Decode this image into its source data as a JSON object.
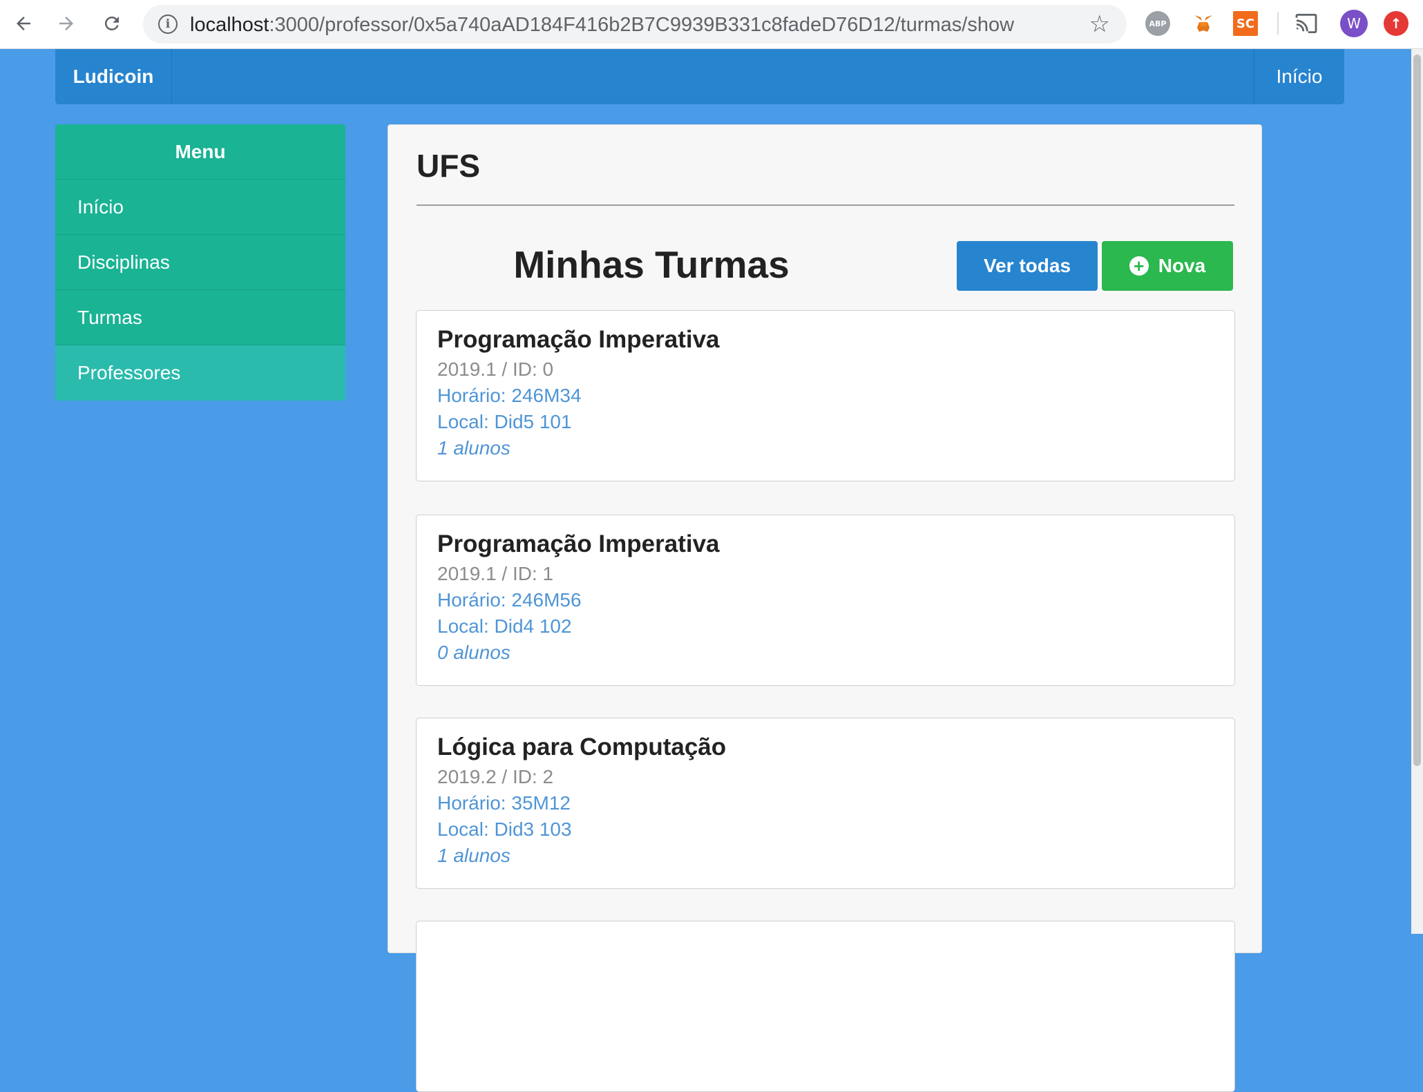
{
  "browser": {
    "url_host": "localhost",
    "url_rest": ":3000/professor/0x5a740aAD184F416b2B7C9939B331c8fadeD76D12/turmas/show",
    "extensions": [
      "ABP",
      "SC",
      "W"
    ]
  },
  "navbar": {
    "brand": "Ludicoin",
    "home_label": "Início"
  },
  "sidebar": {
    "header": "Menu",
    "items": [
      {
        "label": "Início"
      },
      {
        "label": "Disciplinas"
      },
      {
        "label": "Turmas"
      },
      {
        "label": "Professores"
      }
    ]
  },
  "main": {
    "org_title": "UFS",
    "section_title": "Minhas Turmas",
    "view_all_label": "Ver todas",
    "new_label": "Nova",
    "classes": [
      {
        "name": "Programação Imperativa",
        "meta": "2019.1 / ID: 0",
        "schedule": "Horário: 246M34",
        "location": "Local: Did5 101",
        "students": "1 alunos"
      },
      {
        "name": "Programação Imperativa",
        "meta": "2019.1 / ID: 1",
        "schedule": "Horário: 246M56",
        "location": "Local: Did4 102",
        "students": "0 alunos"
      },
      {
        "name": "Lógica para Computação",
        "meta": "2019.2 / ID: 2",
        "schedule": "Horário: 35M12",
        "location": "Local: Did3 103",
        "students": "1 alunos"
      }
    ]
  },
  "colors": {
    "page_bg": "#4a9be8",
    "navbar": "#2784cf",
    "sidebar": "#1ab394",
    "sidebar_active": "#2bbbad",
    "btn_blue": "#2784cf",
    "btn_green": "#2bb84f",
    "link_blue": "#4f95d6"
  }
}
